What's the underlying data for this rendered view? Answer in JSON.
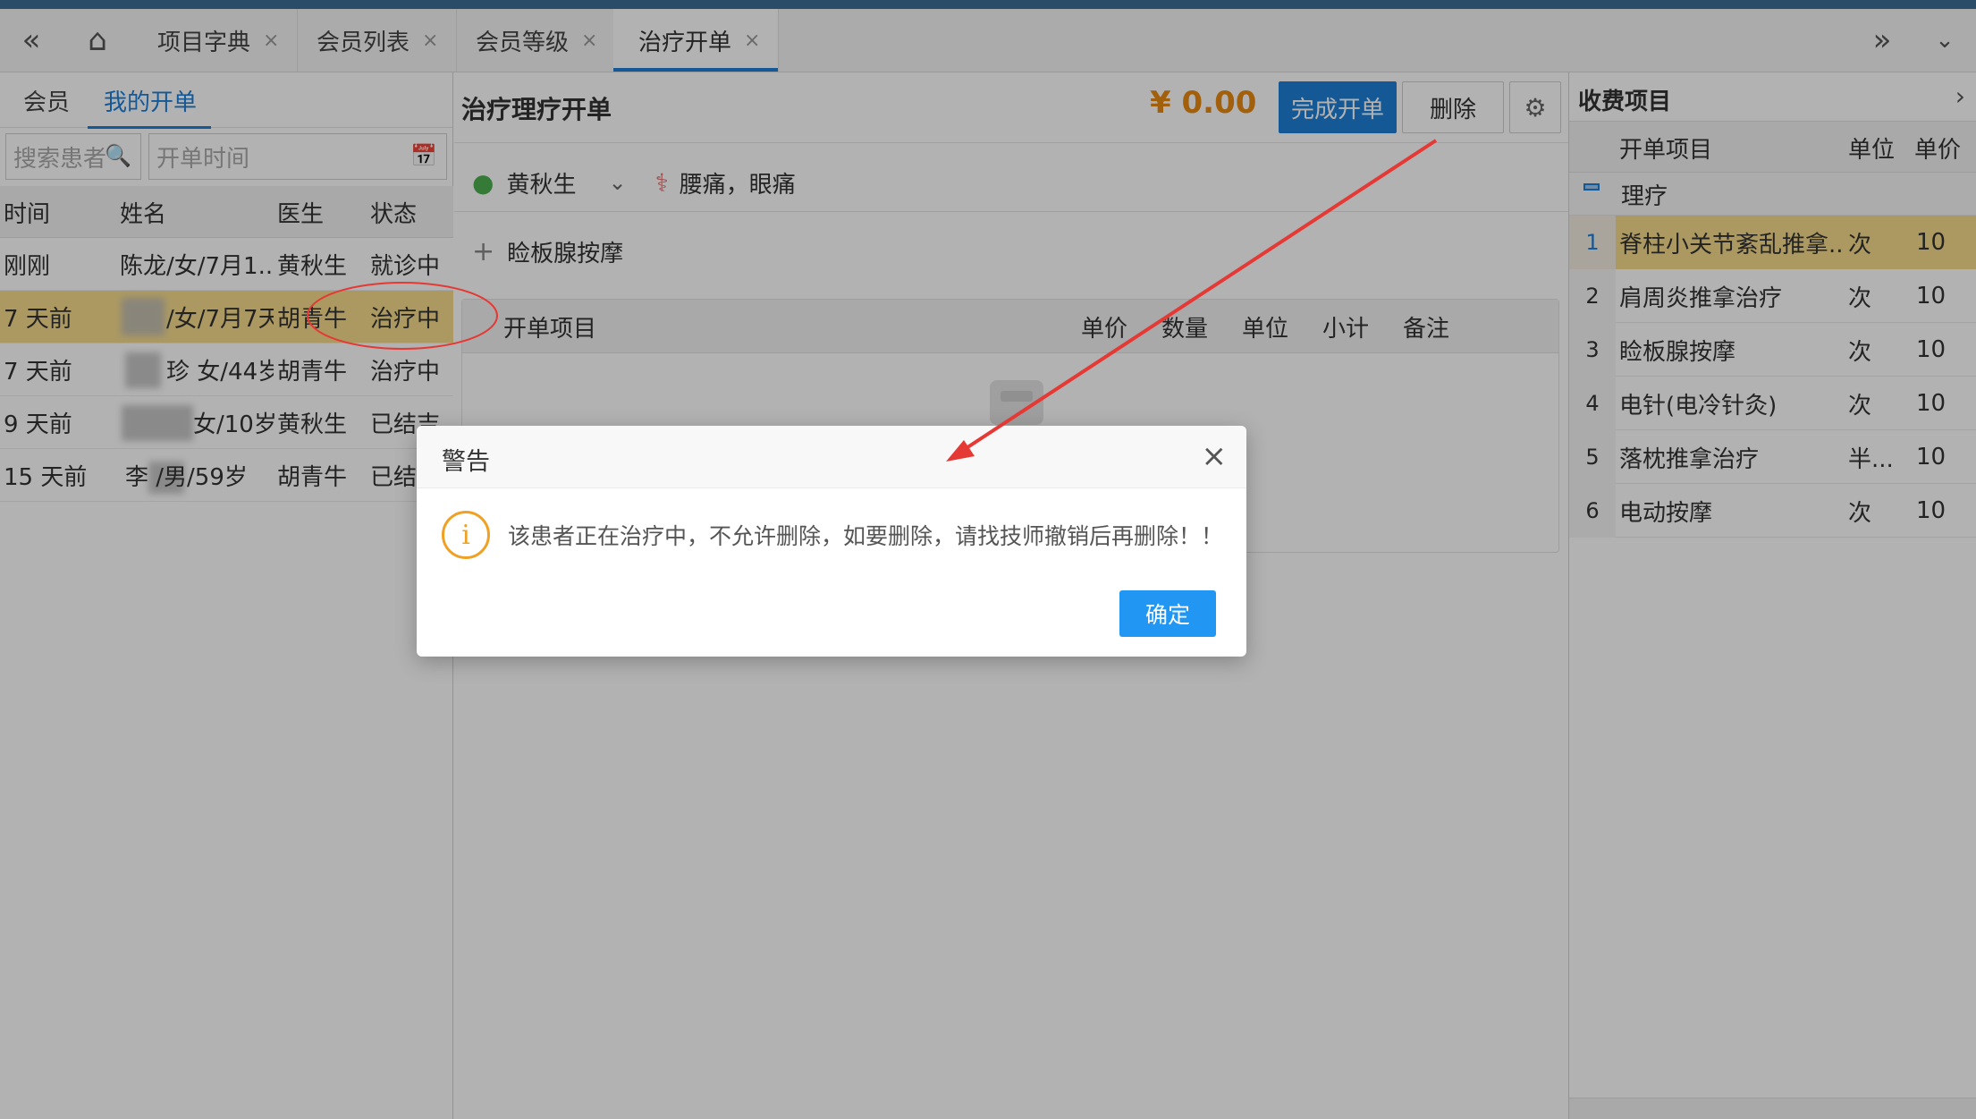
{
  "tabbar": {
    "tabs": [
      {
        "label": "项目字典"
      },
      {
        "label": "会员列表"
      },
      {
        "label": "会员等级"
      },
      {
        "label": "治疗开单"
      }
    ],
    "close_glyph": "×"
  },
  "left": {
    "tabs": [
      {
        "label": "会员"
      },
      {
        "label": "我的开单"
      }
    ],
    "search_placeholder": "搜索患者",
    "date_placeholder": "开单时间",
    "columns": [
      "时间",
      "姓名",
      "医生",
      "状态"
    ],
    "rows": [
      {
        "time": "刚刚",
        "name": "陈龙/女/7月1...",
        "doctor": "黄秋生",
        "status": "就诊中"
      },
      {
        "time": "7 天前",
        "name": "/女/7月7天",
        "doctor": "胡青牛",
        "status": "治疗中"
      },
      {
        "time": "7 天前",
        "name": "珍 女/44岁",
        "doctor": "胡青牛",
        "status": "治疗中"
      },
      {
        "time": "9 天前",
        "name": "女/10岁",
        "doctor": "黄秋生",
        "status": "已结吉"
      },
      {
        "time": "15 天前",
        "name": "李 /男/59岁",
        "doctor": "胡青牛",
        "status": "已结"
      }
    ]
  },
  "center": {
    "title": "治疗理疗开单",
    "amount": "¥ 0.00",
    "complete_button": "完成开单",
    "delete_button": "删除",
    "doctor": "黄秋生",
    "diagnosis": "腰痛，眼痛",
    "add_item": "睑板腺按摩",
    "columns": [
      "开单项目",
      "单价",
      "数量",
      "单位",
      "小计",
      "备注"
    ]
  },
  "right": {
    "title": "收费项目",
    "columns": [
      "开单项目",
      "单位",
      "单价"
    ],
    "group": "理疗",
    "rows": [
      {
        "no": "1",
        "name": "脊柱小关节紊乱推拿...",
        "unit": "次",
        "price": "10"
      },
      {
        "no": "2",
        "name": "肩周炎推拿治疗",
        "unit": "次",
        "price": "10"
      },
      {
        "no": "3",
        "name": "睑板腺按摩",
        "unit": "次",
        "price": "10"
      },
      {
        "no": "4",
        "name": "电针(电冷针灸)",
        "unit": "次",
        "price": "10"
      },
      {
        "no": "5",
        "name": "落枕推拿治疗",
        "unit": "半...",
        "price": "10"
      },
      {
        "no": "6",
        "name": "电动按摩",
        "unit": "次",
        "price": "10"
      }
    ]
  },
  "dialog": {
    "title": "警告",
    "message": "该患者正在治疗中，不允许删除，如要删除，请找技师撤销后再删除！！",
    "ok_button": "确定"
  },
  "colors": {
    "primary": "#1e7fd6",
    "highlight_row": "#f6dc8d",
    "amount": "#e88a12",
    "warning": "#f0a023",
    "annotation": "#e53935"
  }
}
